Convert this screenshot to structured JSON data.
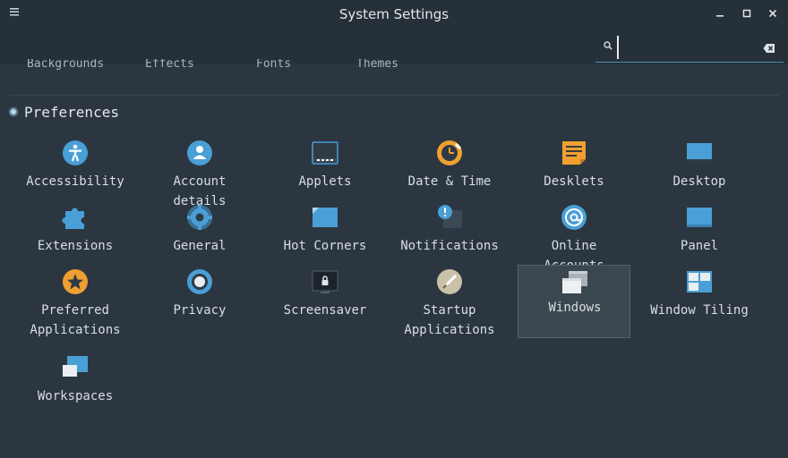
{
  "window": {
    "title": "System Settings",
    "menu_icon": "menu-icon",
    "min_icon": "minimize-icon",
    "max_icon": "maximize-icon",
    "close_icon": "close-icon"
  },
  "search": {
    "value": "",
    "placeholder": "",
    "icon": "search-icon",
    "clear_icon": "clear-text-icon"
  },
  "cut_off_tabs": [
    "Backgrounds",
    "Effects",
    "Fonts",
    "Themes"
  ],
  "section": {
    "title": "Preferences",
    "items": [
      {
        "label": "Accessibility",
        "icon": "accessibility-icon"
      },
      {
        "label": "Account details",
        "icon": "account-details-icon"
      },
      {
        "label": "Applets",
        "icon": "applets-icon"
      },
      {
        "label": "Date & Time",
        "icon": "date-time-icon"
      },
      {
        "label": "Desklets",
        "icon": "desklets-icon"
      },
      {
        "label": "Desktop",
        "icon": "desktop-icon"
      },
      {
        "label": "Extensions",
        "icon": "extensions-icon"
      },
      {
        "label": "General",
        "icon": "general-icon"
      },
      {
        "label": "Hot Corners",
        "icon": "hot-corners-icon"
      },
      {
        "label": "Notifications",
        "icon": "notifications-icon"
      },
      {
        "label": "Online Accounts",
        "icon": "online-accounts-icon"
      },
      {
        "label": "Panel",
        "icon": "panel-icon"
      },
      {
        "label": "Preferred Applications",
        "label_line1": "Preferred",
        "label_line2": "Applications",
        "icon": "preferred-applications-icon"
      },
      {
        "label": "Privacy",
        "icon": "privacy-icon"
      },
      {
        "label": "Screensaver",
        "icon": "screensaver-icon"
      },
      {
        "label": "Startup Applications",
        "label_line1": "Startup",
        "label_line2": "Applications",
        "icon": "startup-applications-icon"
      },
      {
        "label": "Windows",
        "icon": "windows-icon",
        "selected": true
      },
      {
        "label": "Window Tiling",
        "icon": "window-tiling-icon"
      },
      {
        "label": "Workspaces",
        "icon": "workspaces-icon"
      }
    ]
  },
  "colors": {
    "background": "#2b3640",
    "titlebar": "#263039",
    "icon_blue": "#4a9fd6",
    "icon_orange": "#f0a030",
    "selection": "#3b474f"
  }
}
